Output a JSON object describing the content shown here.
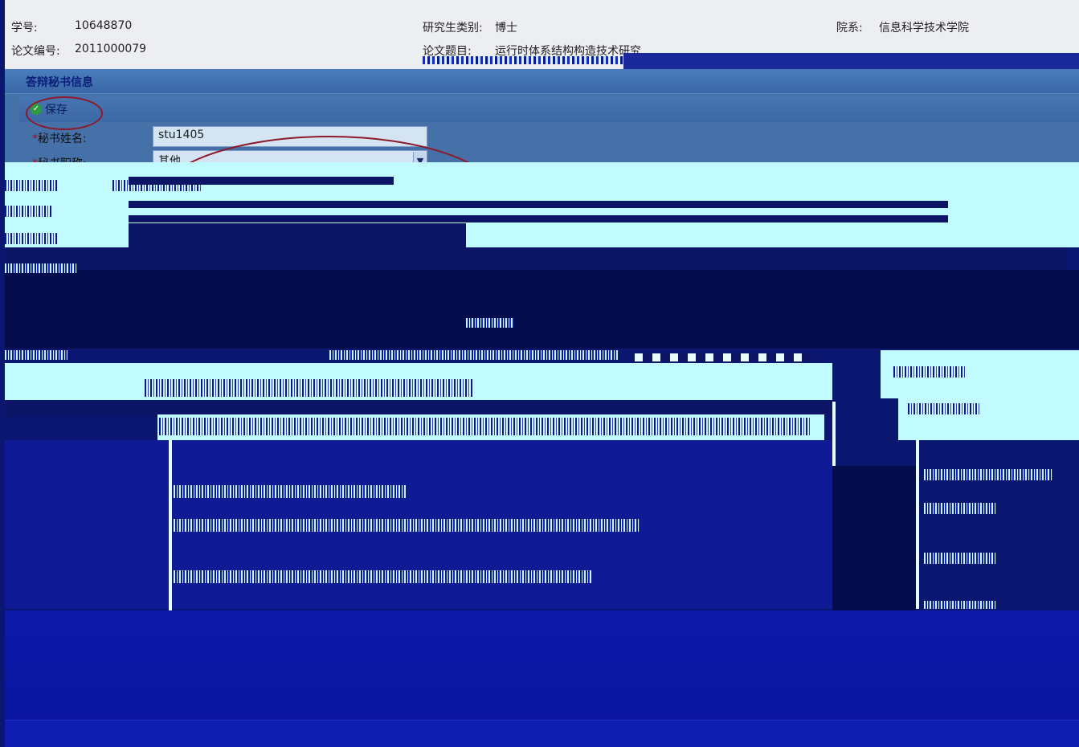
{
  "header": {
    "student_id_label": "学号:",
    "student_id_value": "10648870",
    "thesis_no_label": "论文编号:",
    "thesis_no_value": "2011000079",
    "category_label": "研究生类别:",
    "category_value": "博士",
    "thesis_title_label": "论文题目:",
    "thesis_title_value": "运行时体系结构构造技术研究",
    "department_label": "院系:",
    "department_value": "信息科学技术学院"
  },
  "panel": {
    "title": "答辩秘书信息",
    "save_label": "保存",
    "form": {
      "name_label": "秘书姓名:",
      "name_value": "stu1405",
      "title_label": "秘书职称:",
      "title_value": "其他",
      "required_mark": "*"
    }
  },
  "icons": {
    "save": "check-circle-icon",
    "dropdown": "chevron-down-icon"
  },
  "colors": {
    "header_bg": "#eceef2",
    "panel_bg": "#4670a8",
    "save_icon": "#2e9a3e",
    "annotation_circle": "#8b1a2a",
    "corruption_navy": "#0c1466",
    "corruption_cyan": "#c2fbff"
  }
}
